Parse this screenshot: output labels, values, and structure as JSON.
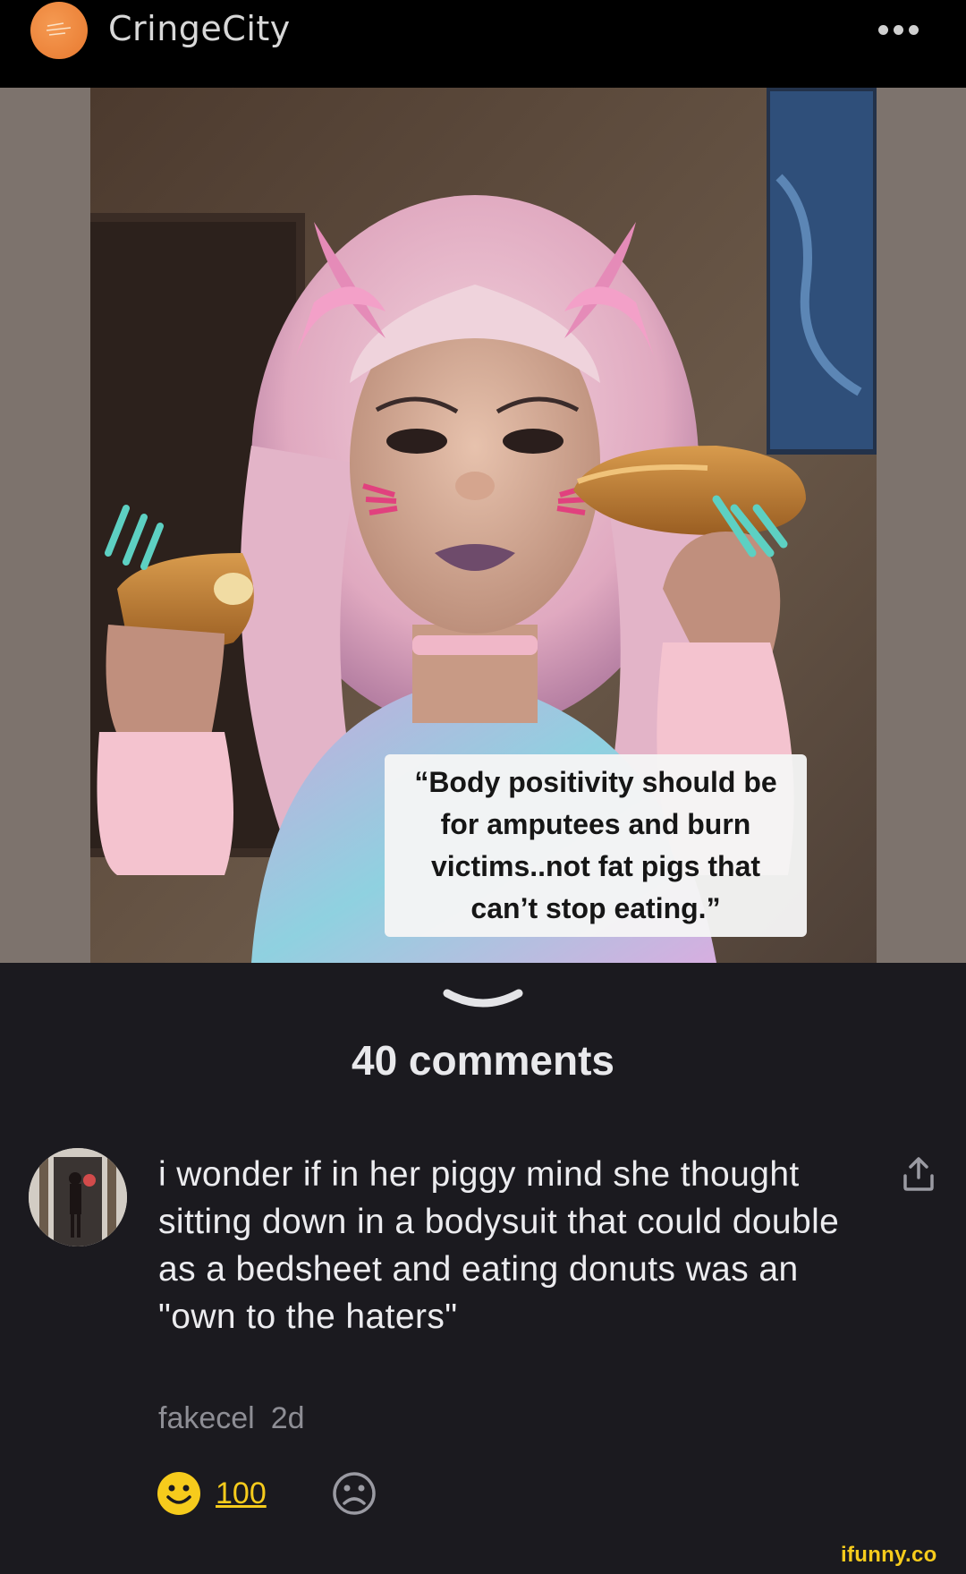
{
  "header": {
    "community_name": "CringeCity",
    "avatar_icon": "community-logo-icon",
    "more_icon": "more-options-icon"
  },
  "media": {
    "caption": "“Body positivity should be for amputees and burn victims..not fat pigs that can’t stop eating.”"
  },
  "comments_section": {
    "collapse_icon": "chevron-down-icon",
    "count_label": "40 comments"
  },
  "comment": {
    "text": "i wonder if in her piggy mind she thought sitting down in a bodysuit that could double as a bedsheet and eating donuts was an \"own to the haters\"",
    "author": "fakecel",
    "time": "2d",
    "smiles": "100",
    "share_icon": "share-icon",
    "smile_icon": "smile-icon",
    "frown_icon": "frown-icon"
  },
  "watermark": "ifunny.co",
  "colors": {
    "background": "#1b1a1f",
    "header": "#000000",
    "accent": "#f6cb1c",
    "community_avatar": "#e8792f"
  }
}
